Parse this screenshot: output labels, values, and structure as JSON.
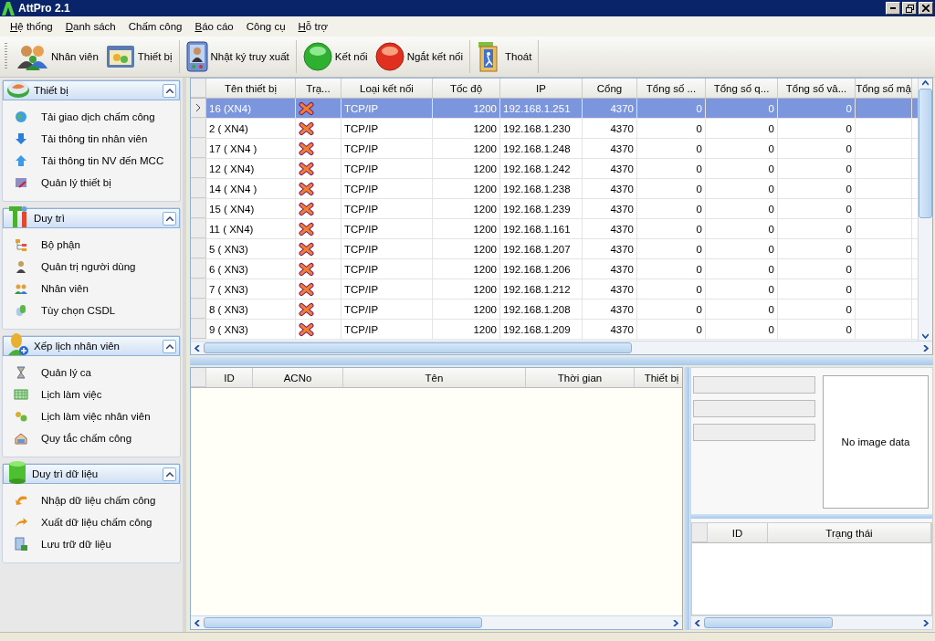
{
  "window": {
    "title": "AttPro 2.1"
  },
  "menu": [
    {
      "label": "Hệ thống",
      "access_key": true
    },
    {
      "label": "Danh sách",
      "access_key": true
    },
    {
      "label": "Chấm công",
      "access_key": false
    },
    {
      "label": "Báo cáo",
      "access_key": true
    },
    {
      "label": "Công cụ",
      "access_key": false
    },
    {
      "label": "Hỗ trợ",
      "access_key": true
    }
  ],
  "toolbar": [
    {
      "buttons": [
        {
          "label": "Nhân viên",
          "kind": "people"
        },
        {
          "label": "Thiết bị",
          "kind": "device"
        }
      ]
    },
    {
      "buttons": [
        {
          "label": "Nhật ký truy xuất",
          "kind": "log"
        }
      ]
    },
    {
      "buttons": [
        {
          "label": "Kết nối",
          "kind": "connect"
        },
        {
          "label": "Ngắt kết nối",
          "kind": "disconnect"
        }
      ]
    },
    {
      "buttons": [
        {
          "label": "Thoát",
          "kind": "exit"
        }
      ]
    }
  ],
  "sidebar": [
    {
      "title": "Thiết bị",
      "expanded": true,
      "items": [
        "Tải giao dịch chấm công",
        "Tải thông tin nhân viên",
        "Tải thông tin NV đến MCC",
        "Quản lý thiết bị"
      ]
    },
    {
      "title": "Duy trì",
      "expanded": true,
      "items": [
        "Bộ phận",
        "Quản trị người dùng",
        "Nhân viên",
        "Tùy chọn CSDL"
      ]
    },
    {
      "title": "Xếp lịch nhân viên",
      "expanded": true,
      "items": [
        "Quản lý ca",
        "Lịch làm việc",
        "Lịch làm việc nhân viên",
        "Quy tắc chấm công"
      ]
    },
    {
      "title": "Duy trì dữ liệu",
      "expanded": true,
      "items": [
        "Nhập dữ liệu chấm công",
        "Xuất dữ liệu chấm công",
        "Lưu trữ dữ liệu"
      ]
    }
  ],
  "device_table": {
    "columns": [
      "Tên thiết bị",
      "Trạ...",
      "Loại kết nối",
      "Tốc độ",
      "IP",
      "Cổng",
      "Tổng số ...",
      "Tổng số q...",
      "Tổng số vâ...",
      "Tổng số mậ"
    ],
    "rows": [
      {
        "selected": true,
        "connected": false,
        "cells": [
          "16 (XN4)",
          "",
          "TCP/IP",
          "1200",
          "192.168.1.251",
          "4370",
          "0",
          "0",
          "0"
        ]
      },
      {
        "selected": false,
        "connected": false,
        "cells": [
          "2 ( XN4)",
          "",
          "TCP/IP",
          "1200",
          "192.168.1.230",
          "4370",
          "0",
          "0",
          "0"
        ]
      },
      {
        "selected": false,
        "connected": false,
        "cells": [
          "17 ( XN4 )",
          "",
          "TCP/IP",
          "1200",
          "192.168.1.248",
          "4370",
          "0",
          "0",
          "0"
        ]
      },
      {
        "selected": false,
        "connected": false,
        "cells": [
          "12 ( XN4)",
          "",
          "TCP/IP",
          "1200",
          "192.168.1.242",
          "4370",
          "0",
          "0",
          "0"
        ]
      },
      {
        "selected": false,
        "connected": false,
        "cells": [
          "14 ( XN4 )",
          "",
          "TCP/IP",
          "1200",
          "192.168.1.238",
          "4370",
          "0",
          "0",
          "0"
        ]
      },
      {
        "selected": false,
        "connected": false,
        "cells": [
          "15 ( XN4)",
          "",
          "TCP/IP",
          "1200",
          "192.168.1.239",
          "4370",
          "0",
          "0",
          "0"
        ]
      },
      {
        "selected": false,
        "connected": false,
        "cells": [
          "11 ( XN4)",
          "",
          "TCP/IP",
          "1200",
          "192.168.1.161",
          "4370",
          "0",
          "0",
          "0"
        ]
      },
      {
        "selected": false,
        "connected": false,
        "cells": [
          "5 ( XN3)",
          "",
          "TCP/IP",
          "1200",
          "192.168.1.207",
          "4370",
          "0",
          "0",
          "0"
        ]
      },
      {
        "selected": false,
        "connected": false,
        "cells": [
          "6 ( XN3)",
          "",
          "TCP/IP",
          "1200",
          "192.168.1.206",
          "4370",
          "0",
          "0",
          "0"
        ]
      },
      {
        "selected": false,
        "connected": false,
        "cells": [
          "7 ( XN3)",
          "",
          "TCP/IP",
          "1200",
          "192.168.1.212",
          "4370",
          "0",
          "0",
          "0"
        ]
      },
      {
        "selected": false,
        "connected": false,
        "cells": [
          "8 ( XN3)",
          "",
          "TCP/IP",
          "1200",
          "192.168.1.208",
          "4370",
          "0",
          "0",
          "0"
        ]
      },
      {
        "selected": false,
        "connected": false,
        "cells": [
          "9 ( XN3)",
          "",
          "TCP/IP",
          "1200",
          "192.168.1.209",
          "4370",
          "0",
          "0",
          "0"
        ]
      }
    ]
  },
  "log_table": {
    "columns": [
      "ID",
      "ACNo",
      "Tên",
      "Thời gian",
      "Thiết bị"
    ]
  },
  "detail": {
    "image_placeholder": "No image data"
  },
  "status_table": {
    "columns": [
      "ID",
      "Trạng thái"
    ]
  }
}
